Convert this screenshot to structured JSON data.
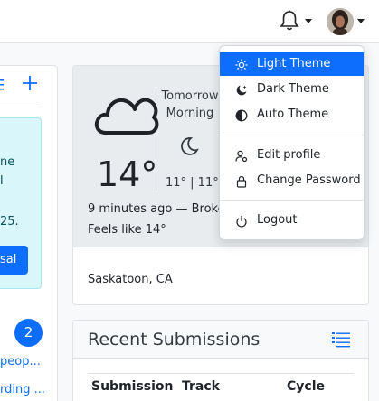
{
  "colors": {
    "primary": "#0d6efd",
    "info_bg": "#d9f6fb",
    "card_bg": "#e9ecef"
  },
  "left_panel": {
    "info_lines": [
      "ne",
      "l",
      "25."
    ],
    "proposal_button": "osal",
    "badge_count": "2",
    "links": [
      "peop...",
      "rding ..."
    ]
  },
  "weather": {
    "current_temp": "14°",
    "tomorrow_label": "Tomorrow Morning",
    "tomorrow_range": "11° | 11°",
    "updated": "9 minutes ago — Broke",
    "feels_like": "Feels like 14°",
    "location": "Saskatoon, CA",
    "current_icon": "cloud-icon",
    "tomorrow_icon": "moon-icon"
  },
  "submissions": {
    "title": "Recent Submissions",
    "columns": [
      "Submission",
      "Track",
      "Cycle"
    ]
  },
  "user_menu": {
    "items": [
      {
        "label": "Light Theme",
        "icon": "sun-icon",
        "active": true
      },
      {
        "label": "Dark Theme",
        "icon": "moon-stars-icon"
      },
      {
        "label": "Auto Theme",
        "icon": "circle-half-icon"
      },
      {
        "label": "Edit profile",
        "icon": "person-gear-icon"
      },
      {
        "label": "Change Password",
        "icon": "lock-icon"
      },
      {
        "label": "Logout",
        "icon": "power-icon"
      }
    ]
  }
}
